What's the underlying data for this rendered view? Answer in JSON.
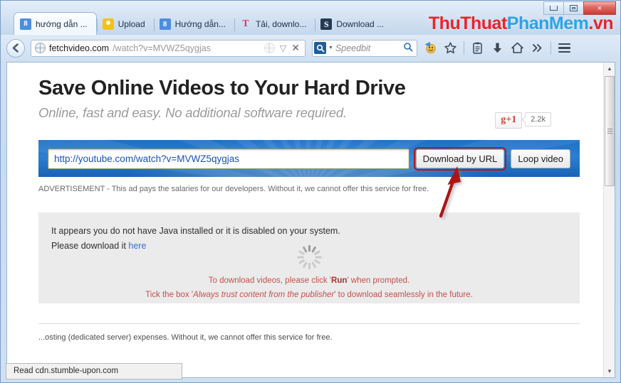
{
  "browser": {
    "tabs": [
      {
        "label": "hướng dẫn ...",
        "icon": "google-favicon",
        "active": true
      },
      {
        "label": "Upload",
        "icon": "lightbulb-favicon",
        "active": false
      },
      {
        "label": "Hướng dẫn...",
        "icon": "google-favicon",
        "active": false
      },
      {
        "label": "Tải, downlo...",
        "icon": "tumblr-favicon",
        "active": false
      },
      {
        "label": "Download ...",
        "icon": "stumbleupon-favicon",
        "active": false
      }
    ],
    "watermark": {
      "part1": "Thu",
      "part2": "Thuat",
      "part3": "PhanMem",
      "part4": ".vn"
    },
    "window_controls": {
      "minimize": "minimize-button",
      "maximize": "maximize-button",
      "close": "×"
    },
    "address": {
      "host": "fetchvideo.com",
      "path": "/watch?v=MVWZ5qygjas",
      "stop_label": "✕",
      "dropdown_label": "▽"
    },
    "search": {
      "placeholder": "Speedbit",
      "value": "",
      "caret": "▼"
    },
    "toolbar_icons": [
      "speedbit-face-icon",
      "bookmark-star-icon",
      "reading-list-icon",
      "downloads-icon",
      "home-icon",
      "overflow-chevrons-icon",
      "menu-hamburger-icon"
    ],
    "status_text": "Read cdn.stumble-upon.com"
  },
  "page": {
    "headline": "Save Online Videos to Your Hard Drive",
    "subline": "Online, fast and easy. No additional software required.",
    "gplus": {
      "label": "g+1",
      "count": "2.2k"
    },
    "form": {
      "url_value": "http://youtube.com/watch?v=MVWZ5qygjas",
      "download_button": "Download by URL",
      "loop_button": "Loop video"
    },
    "ad_note": "ADVERTISEMENT - This ad pays the salaries for our developers. Without it, we cannot offer this service for free.",
    "java_panel": {
      "line1": "It appears you do not have Java installed or it is disabled on your system.",
      "line2_prefix": "Please download it ",
      "line2_link": "here",
      "red_line1_a": "To download videos, please click '",
      "red_line1_b": "Run",
      "red_line1_c": "' when prompted.",
      "red_line2_a": "Tick the box '",
      "red_line2_b": "Always trust content from the publisher",
      "red_line2_c": "' to download seamlessly in the future."
    },
    "bottom_note": "...osting (dedicated server) expenses. Without it, we cannot offer this service for free."
  },
  "colors": {
    "accent_blue": "#2a7fd4",
    "annotation_red": "#b3191d",
    "link_blue": "#2f6fcf",
    "watermark_red": "#e8242a",
    "watermark_blue": "#2aa3e8"
  }
}
